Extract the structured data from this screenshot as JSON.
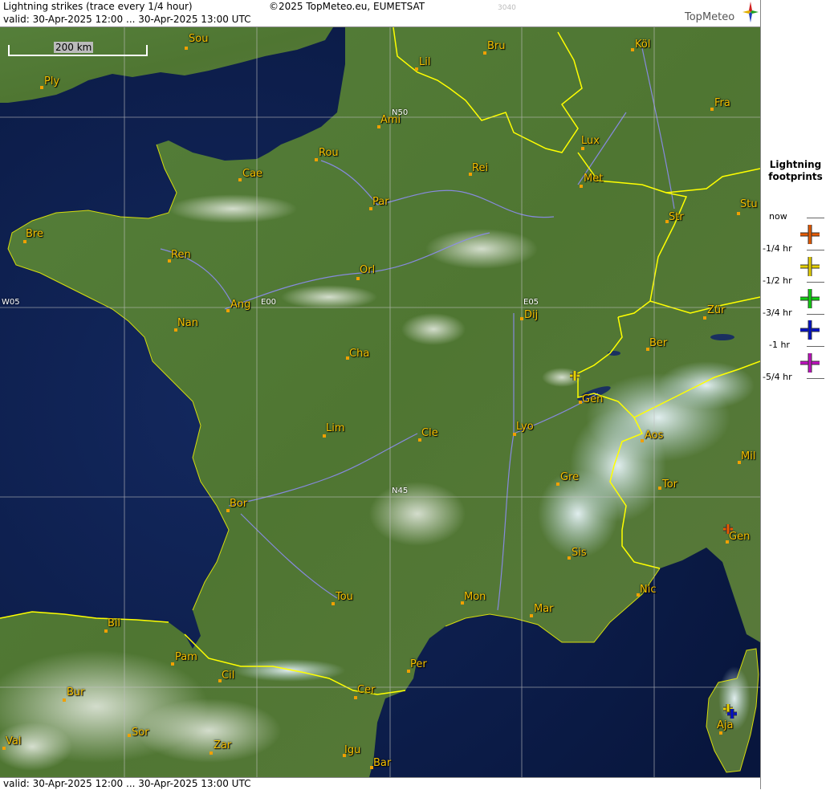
{
  "header": {
    "title": "Lightning strikes (trace every 1/4 hour)",
    "copyright": "©2025 TopMeteo.eu, EUMETSAT",
    "valid": "valid:  30-Apr-2025 12:00 ... 30-Apr-2025 13:00 UTC",
    "tile_id": "3040",
    "brand": "TopMeteo"
  },
  "footer": {
    "valid": "valid:  30-Apr-2025 12:00 ... 30-Apr-2025 13:00 UTC"
  },
  "scale": {
    "label": "200 km"
  },
  "grid_labels": [
    "N50",
    "N45",
    "W05",
    "E00",
    "E05"
  ],
  "cities": [
    "Sou",
    "Ply",
    "Lil",
    "Bru",
    "Köl",
    "Ami",
    "Fra",
    "Lux",
    "Rou",
    "Cae",
    "Rei",
    "Met",
    "Par",
    "Str",
    "Stu",
    "Bre",
    "Ren",
    "Orl",
    "Ang",
    "Dij",
    "Zür",
    "Nan",
    "Ber",
    "Cha",
    "Gen",
    "Lim",
    "Cle",
    "Lyo",
    "Aos",
    "Mil",
    "Gre",
    "Tor",
    "Bor",
    "Gen",
    "Sis",
    "Tou",
    "Mon",
    "Mar",
    "Nic",
    "Bil",
    "Pam",
    "Cil",
    "Per",
    "Bur",
    "Cer",
    "Sor",
    "Aja",
    "Zar",
    "Val",
    "Igu",
    "Bar"
  ],
  "legend": {
    "title_line1": "Lightning",
    "title_line2": "footprints",
    "items": [
      {
        "label": "now",
        "color": null
      },
      {
        "label": "-1/4 hr",
        "color": "#e65a00"
      },
      {
        "label": "-1/2 hr",
        "color": "#e6d000"
      },
      {
        "label": "-3/4 hr",
        "color": "#10d010"
      },
      {
        "label": "-1 hr",
        "color": "#0010c8"
      },
      {
        "label": "-5/4 hr",
        "color": "#c010c0"
      }
    ]
  },
  "strikes": [
    {
      "name": "strike-geneva",
      "color": "#e6d000"
    },
    {
      "name": "strike-genoa",
      "color": "#e65a00"
    },
    {
      "name": "strike-corsica-1",
      "color": "#e6d000"
    },
    {
      "name": "strike-corsica-2",
      "color": "#0010c8"
    }
  ],
  "colors": {
    "sea": "#0a1a45",
    "land": "#4e7a33",
    "border": "#ffff00",
    "river": "#8c8cf0",
    "city": "#f5c000"
  }
}
